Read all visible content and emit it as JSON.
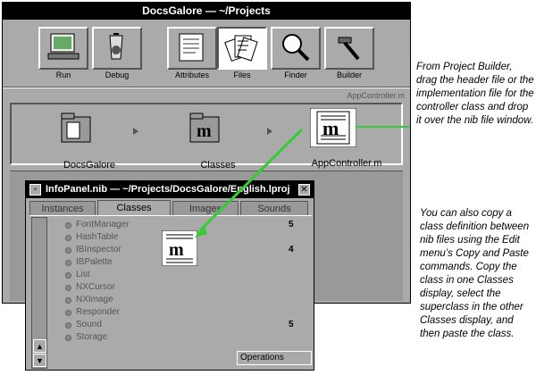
{
  "project_window": {
    "title": "DocsGalore — ~/Projects",
    "toolbar": [
      {
        "label": "Run",
        "icon": "run-icon",
        "selected": false
      },
      {
        "label": "Debug",
        "icon": "debug-icon",
        "selected": false
      },
      {
        "label": "Attributes",
        "icon": "attributes-icon",
        "selected": false
      },
      {
        "label": "Files",
        "icon": "files-icon",
        "selected": true
      },
      {
        "label": "Finder",
        "icon": "finder-icon",
        "selected": false
      },
      {
        "label": "Builder",
        "icon": "builder-icon",
        "selected": false
      }
    ],
    "subtitle": "AppController.m",
    "browser": [
      {
        "label": "DocsGalore"
      },
      {
        "label": "Classes"
      },
      {
        "label": "AppController.m"
      }
    ]
  },
  "nib_window": {
    "title": "InfoPanel.nib — ~/Projects/DocsGalore/English.lproj",
    "tabs": [
      "Instances",
      "Classes",
      "Images",
      "Sounds"
    ],
    "active_tab": "Classes",
    "rows": [
      {
        "name": "FontManager",
        "outlets": "",
        "actions": "5"
      },
      {
        "name": "HashTable",
        "outlets": "",
        "actions": ""
      },
      {
        "name": "IBInspector",
        "outlets": "",
        "actions": "4"
      },
      {
        "name": "IBPalette",
        "outlets": "",
        "actions": ""
      },
      {
        "name": "List",
        "outlets": "",
        "actions": ""
      },
      {
        "name": "NXCursor",
        "outlets": "",
        "actions": ""
      },
      {
        "name": "NXImage",
        "outlets": "",
        "actions": ""
      },
      {
        "name": "Responder",
        "outlets": "",
        "actions": ""
      },
      {
        "name": "Sound",
        "outlets": "",
        "actions": "5"
      },
      {
        "name": "Storage",
        "outlets": "",
        "actions": ""
      }
    ],
    "operations_label": "Operations"
  },
  "callouts": {
    "top": "From Project Builder, drag the header file or the implementation file for the controller class and drop it over the nib file window.",
    "bottom": "You can also copy a class definition between nib files using the Edit menu’s Copy and Paste commands. Copy the class in one Classes display, select the superclass in the other Classes display, and then paste the class."
  },
  "colors": {
    "drag_arrow": "#33cc33",
    "window_gray": "#aaaaaa",
    "titlebar": "#000000"
  }
}
